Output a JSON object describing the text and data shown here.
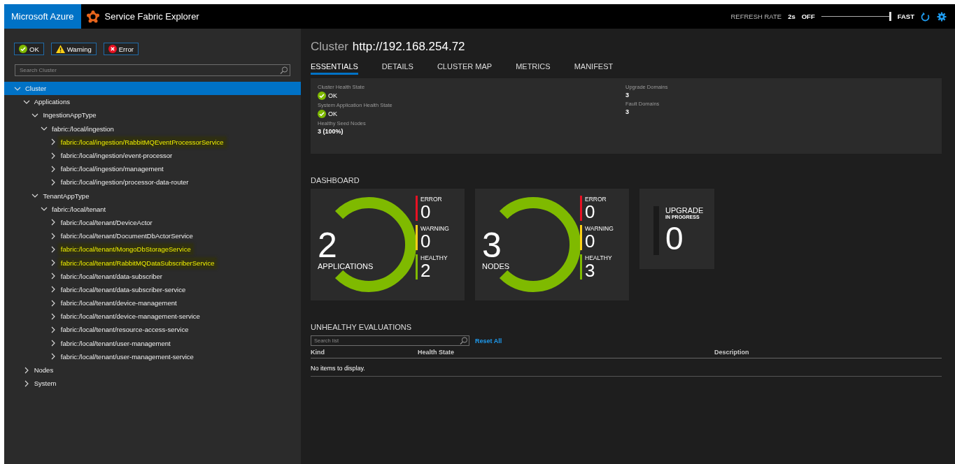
{
  "header": {
    "brand": "Microsoft Azure",
    "app_title": "Service Fabric Explorer",
    "refresh": {
      "label": "REFRESH RATE",
      "value": "2s",
      "off": "OFF",
      "fast": "FAST",
      "level": 1
    }
  },
  "filters": [
    {
      "label": "OK",
      "kind": "ok"
    },
    {
      "label": "Warning",
      "kind": "warning"
    },
    {
      "label": "Error",
      "kind": "error"
    }
  ],
  "search": {
    "placeholder": "Search Cluster"
  },
  "tree": [
    {
      "label": "Cluster",
      "selected": true,
      "expanded": true,
      "highlighted": false,
      "children": [
        {
          "label": "Applications",
          "selected": false,
          "expanded": true,
          "highlighted": false,
          "children": [
            {
              "label": "IngestionAppType",
              "selected": false,
              "expanded": true,
              "highlighted": false,
              "children": [
                {
                  "label": "fabric:/local/ingestion",
                  "selected": false,
                  "expanded": true,
                  "highlighted": false,
                  "children": [
                    {
                      "label": "fabric:/local/ingestion/RabbitMQEventProcessorService",
                      "selected": false,
                      "expanded": false,
                      "highlighted": true
                    },
                    {
                      "label": "fabric:/local/ingestion/event-processor",
                      "selected": false,
                      "expanded": false,
                      "highlighted": false
                    },
                    {
                      "label": "fabric:/local/ingestion/management",
                      "selected": false,
                      "expanded": false,
                      "highlighted": false
                    },
                    {
                      "label": "fabric:/local/ingestion/processor-data-router",
                      "selected": false,
                      "expanded": false,
                      "highlighted": false
                    }
                  ]
                }
              ]
            },
            {
              "label": "TenantAppType",
              "selected": false,
              "expanded": true,
              "highlighted": false,
              "children": [
                {
                  "label": "fabric:/local/tenant",
                  "selected": false,
                  "expanded": true,
                  "highlighted": false,
                  "children": [
                    {
                      "label": "fabric:/local/tenant/DeviceActor",
                      "selected": false,
                      "expanded": false,
                      "highlighted": false
                    },
                    {
                      "label": "fabric:/local/tenant/DocumentDbActorService",
                      "selected": false,
                      "expanded": false,
                      "highlighted": false
                    },
                    {
                      "label": "fabric:/local/tenant/MongoDbStorageService",
                      "selected": false,
                      "expanded": false,
                      "highlighted": true
                    },
                    {
                      "label": "fabric:/local/tenant/RabbitMQDataSubscriberService",
                      "selected": false,
                      "expanded": false,
                      "highlighted": true
                    },
                    {
                      "label": "fabric:/local/tenant/data-subscriber",
                      "selected": false,
                      "expanded": false,
                      "highlighted": false
                    },
                    {
                      "label": "fabric:/local/tenant/data-subscriber-service",
                      "selected": false,
                      "expanded": false,
                      "highlighted": false
                    },
                    {
                      "label": "fabric:/local/tenant/device-management",
                      "selected": false,
                      "expanded": false,
                      "highlighted": false
                    },
                    {
                      "label": "fabric:/local/tenant/device-management-service",
                      "selected": false,
                      "expanded": false,
                      "highlighted": false
                    },
                    {
                      "label": "fabric:/local/tenant/resource-access-service",
                      "selected": false,
                      "expanded": false,
                      "highlighted": false
                    },
                    {
                      "label": "fabric:/local/tenant/user-management",
                      "selected": false,
                      "expanded": false,
                      "highlighted": false
                    },
                    {
                      "label": "fabric:/local/tenant/user-management-service",
                      "selected": false,
                      "expanded": false,
                      "highlighted": false
                    }
                  ]
                }
              ]
            }
          ]
        },
        {
          "label": "Nodes",
          "selected": false,
          "expanded": false,
          "highlighted": false
        },
        {
          "label": "System",
          "selected": false,
          "expanded": false,
          "highlighted": false
        }
      ]
    }
  ],
  "main": {
    "title": {
      "kind": "Cluster",
      "value": "http://192.168.254.72"
    },
    "tabs": [
      {
        "label": "ESSENTIALS",
        "selected": true
      },
      {
        "label": "DETAILS",
        "selected": false
      },
      {
        "label": "CLUSTER MAP",
        "selected": false
      },
      {
        "label": "METRICS",
        "selected": false
      },
      {
        "label": "MANIFEST",
        "selected": false
      }
    ],
    "essentials": {
      "left": [
        {
          "label": "Cluster Health State",
          "value": "OK",
          "kind": "status"
        },
        {
          "label": "System Application Health State",
          "value": "OK",
          "kind": "status"
        },
        {
          "label": "Healthy Seed Nodes",
          "value": "3 (100%)",
          "kind": "text"
        }
      ],
      "right": [
        {
          "label": "Upgrade Domains",
          "value": "3",
          "kind": "text"
        },
        {
          "label": "Fault Domains",
          "value": "3",
          "kind": "text"
        }
      ]
    },
    "dashboard": {
      "title": "DASHBOARD",
      "tiles": [
        {
          "kind": "health",
          "count": "2",
          "label": "APPLICATIONS",
          "stats": [
            {
              "label": "ERROR",
              "value": "0",
              "color": "#e81123"
            },
            {
              "label": "WARNING",
              "value": "0",
              "color": "#fcd116"
            },
            {
              "label": "HEALTHY",
              "value": "2",
              "color": "#7fba00"
            }
          ]
        },
        {
          "kind": "health",
          "count": "3",
          "label": "NODES",
          "stats": [
            {
              "label": "ERROR",
              "value": "0",
              "color": "#e81123"
            },
            {
              "label": "WARNING",
              "value": "0",
              "color": "#fcd116"
            },
            {
              "label": "HEALTHY",
              "value": "3",
              "color": "#7fba00"
            }
          ]
        },
        {
          "kind": "upgrade",
          "title": "UPGRADE",
          "subtitle": "IN PROGRESS",
          "count": "0"
        }
      ]
    },
    "unhealthy": {
      "title": "UNHEALTHY EVALUATIONS",
      "search_placeholder": "Search list",
      "reset": "Reset All",
      "columns": [
        "Kind",
        "Health State",
        "Description"
      ],
      "empty": "No items to display."
    }
  }
}
